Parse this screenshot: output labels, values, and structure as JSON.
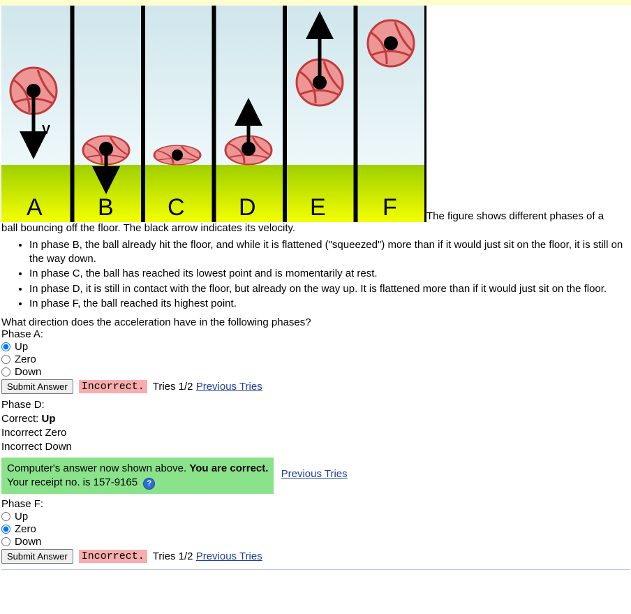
{
  "figure": {
    "panel_labels": [
      "A",
      "B",
      "C",
      "D",
      "E",
      "F"
    ],
    "velocity_label": "V"
  },
  "intro": {
    "right_text": "The figure shows different phases of a",
    "below_text": "ball bouncing off the floor. The black arrow indicates its velocity."
  },
  "bullets": [
    "In phase B, the ball already hit the floor, and while it is flattened (\"squeezed\") more than if it would just sit on the floor, it is still on the way down.",
    "In phase C, the ball has reached its lowest point and is momentarily at rest.",
    "In phase D, it is still in contact with the floor, but already on the way up. It is flattened more than if it would just sit on the floor.",
    "In phase F, the ball reached its highest point."
  ],
  "question_prompt": "What direction does the acceleration have in the following phases?",
  "phaseA": {
    "label": "Phase A:",
    "options": [
      "Up",
      "Zero",
      "Down"
    ],
    "selected": "Up",
    "submit": "Submit Answer",
    "feedback": "Incorrect.",
    "tries": "Tries 1/2",
    "prev": "Previous Tries"
  },
  "phaseD": {
    "label": "Phase D:",
    "correct_line_prefix": "Correct: ",
    "correct_line_value": "Up",
    "incorrect1": "Incorrect Zero",
    "incorrect2": "Incorrect Down",
    "box_prefix": "Computer's answer now shown above. ",
    "box_bold": "You are correct.",
    "box_receipt": "Your receipt no. is 157-9165",
    "help": "?",
    "prev": "Previous Tries"
  },
  "phaseF": {
    "label": "Phase F:",
    "options": [
      "Up",
      "Zero",
      "Down"
    ],
    "selected": "Zero",
    "submit": "Submit Answer",
    "feedback": "Incorrect.",
    "tries": "Tries 1/2",
    "prev": "Previous Tries"
  },
  "chart_data": {
    "type": "diagram",
    "description": "Six-panel sequence (A–F) of a ball bouncing off a floor. Black arrows show velocity direction at each phase.",
    "panels": [
      {
        "label": "A",
        "ball_y": "high",
        "squash": 1.0,
        "velocity": "down"
      },
      {
        "label": "B",
        "ball_y": "touching_floor",
        "squash": 0.7,
        "velocity": "down"
      },
      {
        "label": "C",
        "ball_y": "lowest",
        "squash": 0.45,
        "velocity": "zero"
      },
      {
        "label": "D",
        "ball_y": "touching_floor",
        "squash": 0.7,
        "velocity": "up"
      },
      {
        "label": "E",
        "ball_y": "mid",
        "squash": 1.0,
        "velocity": "up"
      },
      {
        "label": "F",
        "ball_y": "highest",
        "squash": 1.0,
        "velocity": "zero"
      }
    ],
    "floor_color": "#b7d500",
    "sky_gradient": [
      "#d7e9ee",
      "#eef7f9"
    ]
  }
}
